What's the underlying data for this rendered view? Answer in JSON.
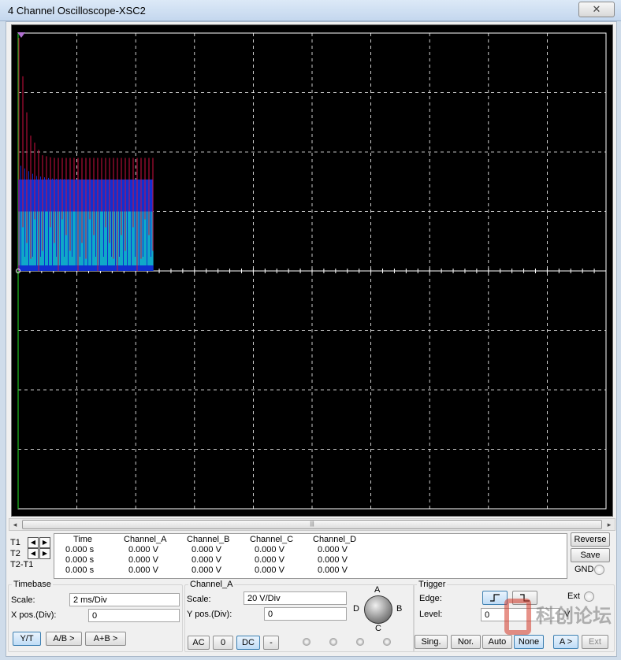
{
  "window": {
    "title": "4 Channel Oscilloscope-XSC2",
    "close_glyph": "✕"
  },
  "scroll": {
    "left": "◂",
    "right": "▸",
    "grip": "|||"
  },
  "cursors": {
    "t1": "T1",
    "t2": "T2",
    "t2t1": "T2-T1",
    "left_arrow": "◀",
    "right_arrow": "▶",
    "headers": [
      "Time",
      "Channel_A",
      "Channel_B",
      "Channel_C",
      "Channel_D"
    ],
    "rows": [
      [
        "0.000 s",
        "0.000 V",
        "0.000 V",
        "0.000 V",
        "0.000 V"
      ],
      [
        "0.000 s",
        "0.000 V",
        "0.000 V",
        "0.000 V",
        "0.000 V"
      ],
      [
        "0.000 s",
        "0.000 V",
        "0.000 V",
        "0.000 V",
        "0.000 V"
      ]
    ]
  },
  "side": {
    "reverse": "Reverse",
    "save": "Save",
    "gnd": "GND"
  },
  "timebase": {
    "legend": "Timebase",
    "scale_label": "Scale:",
    "scale_value": "2 ms/Div",
    "xpos_label": "X pos.(Div):",
    "xpos_value": "0",
    "yt": "Y/T",
    "ab": "A/B >",
    "apb": "A+B >"
  },
  "channel": {
    "legend": "Channel_A",
    "scale_label": "Scale:",
    "scale_value": "20  V/Div",
    "ypos_label": "Y pos.(Div):",
    "ypos_value": "0",
    "ac": "AC",
    "zero": "0",
    "dc": "DC",
    "minus": "-",
    "knob": {
      "a": "A",
      "b": "B",
      "c": "C",
      "d": "D"
    }
  },
  "trigger": {
    "legend": "Trigger",
    "edge_label": "Edge:",
    "level_label": "Level:",
    "level_value": "0",
    "level_unit": "V",
    "ext_label": "Ext",
    "sing": "Sing.",
    "nor": "Nor.",
    "auto": "Auto",
    "none": "None",
    "a_gt": "A >",
    "ext_btn": "Ext"
  },
  "watermark": {
    "text": "科创论坛"
  },
  "colors": {
    "screen_bg": "#000000",
    "grid": "#ffffff",
    "channel_a": "#d01040",
    "channel_b": "#1030d0",
    "channel_c": "#10a8c8",
    "axis_v": "#20c020"
  },
  "chart_data": {
    "type": "line",
    "grid": true,
    "xlim_div": [
      0,
      10
    ],
    "ylim_div": [
      -4,
      4
    ],
    "series": [
      {
        "name": "Channel_A",
        "color": "#d01040",
        "x_div": [
          0,
          0.05,
          0.1,
          0.2,
          0.4,
          0.6,
          2.3
        ],
        "y_div": [
          4.0,
          3.7,
          3.0,
          2.3,
          1.95,
          1.9,
          1.9
        ]
      },
      {
        "name": "Channel_B",
        "color": "#1030d0",
        "x_div": [
          0,
          0.3,
          0.6,
          2.3
        ],
        "y_div": [
          1.8,
          1.6,
          1.55,
          1.5
        ]
      },
      {
        "name": "Channel_C",
        "color": "#10a8c8",
        "x_div": [
          0,
          2.3
        ],
        "y_div": [
          1.0,
          1.0
        ]
      }
    ]
  }
}
